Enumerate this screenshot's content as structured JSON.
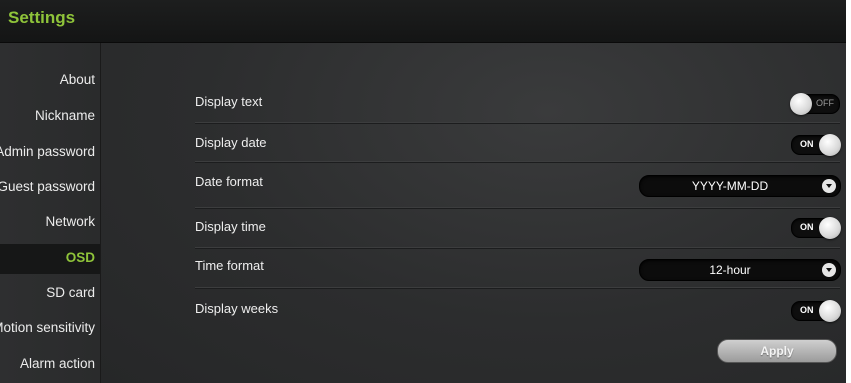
{
  "header": {
    "title": "Settings"
  },
  "sidebar": {
    "items": [
      {
        "label": "About"
      },
      {
        "label": "Nickname"
      },
      {
        "label": "Admin password"
      },
      {
        "label": "Guest password"
      },
      {
        "label": "Network"
      },
      {
        "label": "OSD",
        "active": true
      },
      {
        "label": "SD card"
      },
      {
        "label": "Motion sensitivity"
      },
      {
        "label": "Alarm action"
      }
    ]
  },
  "osd": {
    "display_text": {
      "label": "Display text",
      "toggle": "OFF"
    },
    "display_date": {
      "label": "Display date",
      "toggle": "ON"
    },
    "date_format": {
      "label": "Date format",
      "value": "YYYY-MM-DD"
    },
    "display_time": {
      "label": "Display time",
      "toggle": "ON"
    },
    "time_format": {
      "label": "Time format",
      "value": "12-hour"
    },
    "display_weeks": {
      "label": "Display weeks",
      "toggle": "ON"
    },
    "apply_label": "Apply"
  },
  "colors": {
    "accent": "#8fc43a",
    "background": "#262728",
    "header": "#141515"
  },
  "icons": {
    "select_arrow": "chevron-down-icon"
  }
}
